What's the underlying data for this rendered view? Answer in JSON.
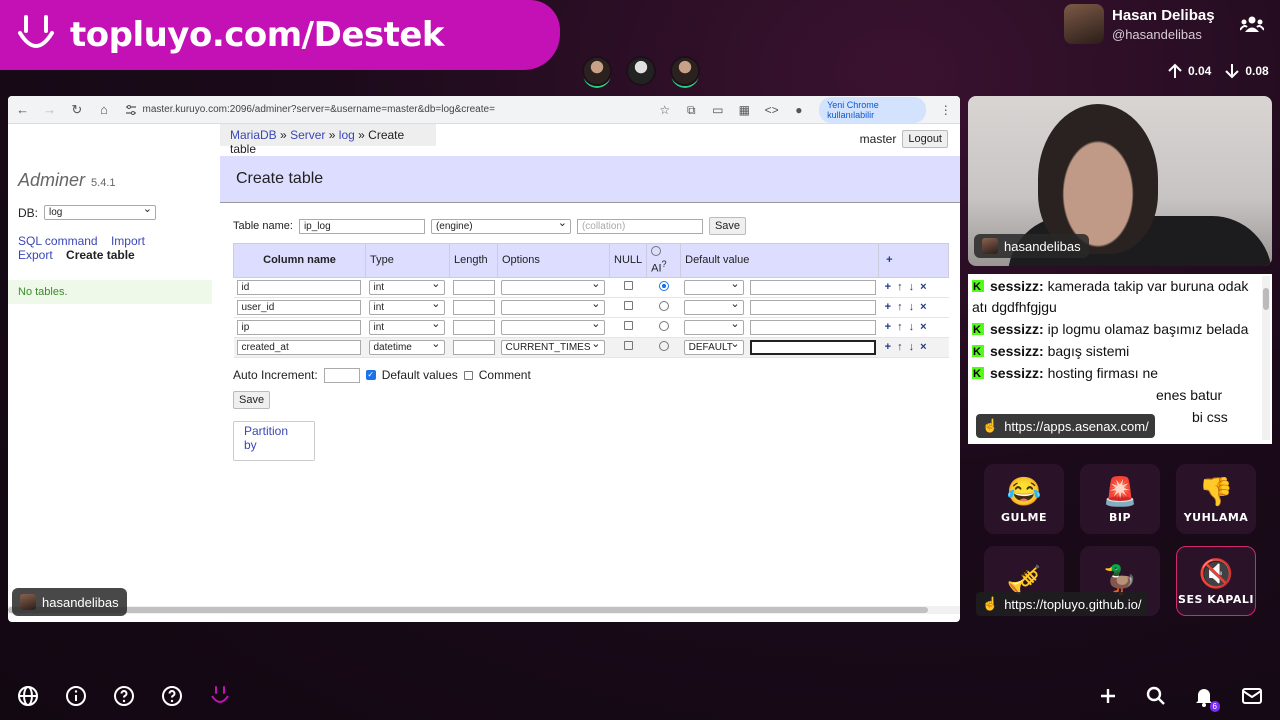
{
  "banner": {
    "url": "topluyo.com/Destek"
  },
  "user": {
    "name": "Hasan Delibaş",
    "handle": "@hasandelibas"
  },
  "rates": {
    "up": "0.04",
    "down": "0.08"
  },
  "browser": {
    "address": "master.kuruyo.com:2096/adminer?server=&username=master&db=log&create=",
    "new_chrome": "Yeni Chrome kullanılabilir"
  },
  "adminer": {
    "crumbs": {
      "mariadb": "MariaDB",
      "server": "Server",
      "log": "log",
      "current": "Create table",
      "sep": "»"
    },
    "login_user": "master",
    "logout": "Logout",
    "brand": "Adminer",
    "version": "5.4.1",
    "db_label": "DB:",
    "db_value": "log",
    "links": {
      "sql": "SQL command",
      "import": "Import",
      "export": "Export",
      "create": "Create table"
    },
    "no_tables": "No tables.",
    "title": "Create table",
    "table_name_label": "Table name:",
    "table_name_value": "ip_log",
    "engine": "(engine)",
    "collation": "(collation)",
    "save": "Save",
    "headers": {
      "column": "Column name",
      "type": "Type",
      "length": "Length",
      "options": "Options",
      "null": "NULL",
      "ai": "AI",
      "ai_sup": "?",
      "default": "Default value",
      "add": "+"
    },
    "rows": [
      {
        "name": "id",
        "type": "int",
        "options": "",
        "default_sel": "",
        "ai": true
      },
      {
        "name": "user_id",
        "type": "int",
        "options": "",
        "default_sel": "",
        "ai": false
      },
      {
        "name": "ip",
        "type": "int",
        "options": "",
        "default_sel": "",
        "ai": false
      },
      {
        "name": "created_at",
        "type": "datetime",
        "options": "CURRENT_TIMES",
        "default_sel": "DEFAULT",
        "ai": false
      }
    ],
    "actions": {
      "add": "+",
      "up": "↑",
      "down": "↓",
      "remove": "×"
    },
    "auto_increment_label": "Auto Increment:",
    "default_values_label": "Default values",
    "comment_label": "Comment",
    "partition": "Partition by"
  },
  "presenter_tag": "hasandelibas",
  "cam_tag": "hasandelibas",
  "chat": [
    {
      "who": "sessizz:",
      "text": " kamerada takip var buruna odak atı dgdfhfgjgu"
    },
    {
      "who": "sessizz:",
      "text": " ip logmu olamaz başımız belada"
    },
    {
      "who": "sessizz:",
      "text": " bagış sistemi"
    },
    {
      "who": "sessizz:",
      "text": " hosting firması ne"
    }
  ],
  "chat_partial": {
    "tail1": "enes batur",
    "tail2": "bi css"
  },
  "link_pills": {
    "apps": "https://apps.asenax.com/",
    "github": "https://topluyo.github.io/"
  },
  "sounds": [
    {
      "emoji": "😂",
      "label": "GULME",
      "icon": "laughing-face-icon"
    },
    {
      "emoji": "🚨",
      "label": "BIP",
      "icon": "siren-icon"
    },
    {
      "emoji": "👎",
      "label": "YUHLAMA",
      "icon": "thumbs-down-icon"
    },
    {
      "emoji": "🎺",
      "label": "",
      "icon": "trumpet-icon"
    },
    {
      "emoji": "🦆",
      "label": "",
      "icon": "duck-icon"
    },
    {
      "emoji": "🔇",
      "label": "SES KAPALI",
      "icon": "muted-speaker-icon"
    }
  ],
  "notifications_badge": "6"
}
